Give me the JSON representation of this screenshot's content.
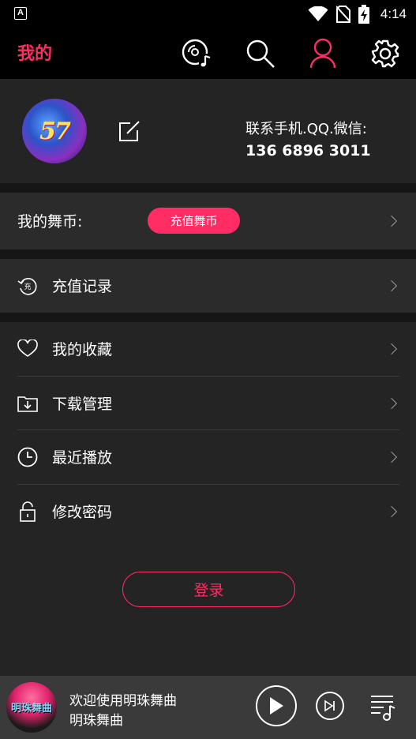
{
  "status_bar": {
    "notification_icon": "a-icon",
    "time": "4:14",
    "icons": [
      "wifi-icon",
      "no-sim-icon",
      "battery-charging-icon"
    ]
  },
  "app_bar": {
    "title": "我的",
    "icons": [
      "disc-music-icon",
      "search-icon",
      "user-icon",
      "gear-icon"
    ],
    "active_color": "#ff2d63"
  },
  "profile": {
    "avatar_text": "57",
    "contact_label": "联系手机.QQ.微信:",
    "contact_number": "136 6896 3011"
  },
  "coins": {
    "label": "我的舞币:",
    "recharge_button": "充值舞币"
  },
  "menu": {
    "recharge_record": "充值记录",
    "items": [
      {
        "label": "我的收藏",
        "icon": "heart-icon"
      },
      {
        "label": "下载管理",
        "icon": "folder-download-icon"
      },
      {
        "label": "最近播放",
        "icon": "clock-icon"
      },
      {
        "label": "修改密码",
        "icon": "lock-icon"
      }
    ]
  },
  "login_button": "登录",
  "player": {
    "title": "欢迎使用明珠舞曲",
    "subtitle": "明珠舞曲",
    "art_text": "明珠舞曲"
  },
  "colors": {
    "accent": "#ff2d63",
    "background": "#242424",
    "bar": "#000000"
  }
}
